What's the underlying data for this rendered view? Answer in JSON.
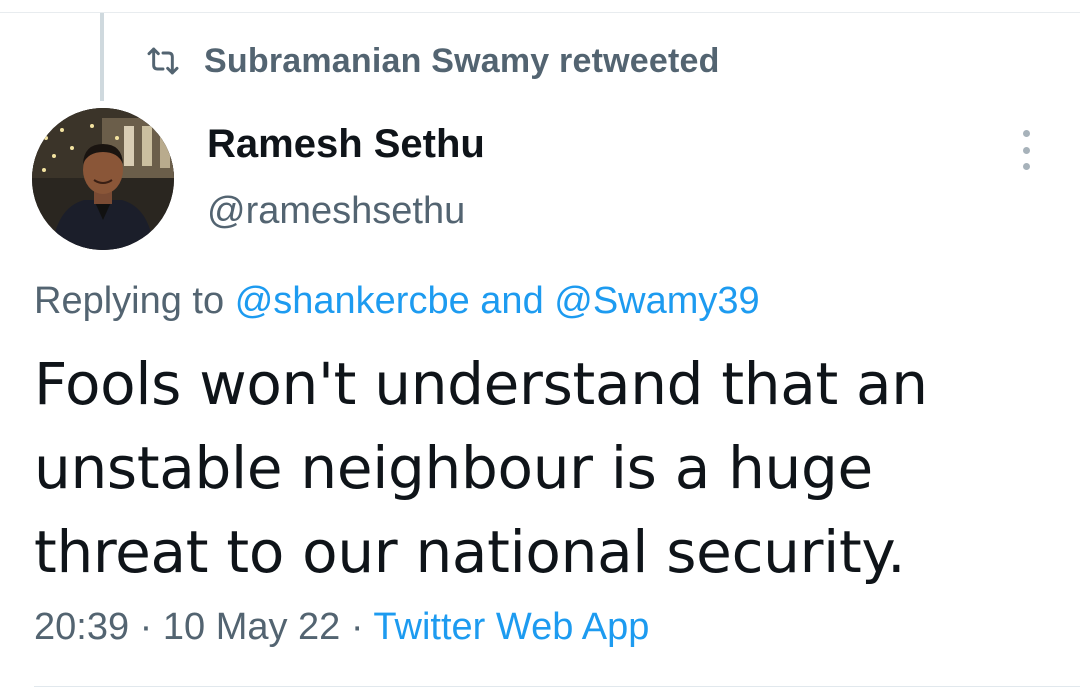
{
  "retweet": {
    "icon": "retweet-icon",
    "text": "Subramanian Swamy retweeted"
  },
  "author": {
    "display_name": "Ramesh Sethu",
    "handle": "@rameshsethu",
    "avatar": "avatar-photo"
  },
  "more_icon": "more-vertical-icon",
  "reply": {
    "prefix": "Replying to",
    "mention1": "@shankercbe",
    "joiner": "and",
    "mention2": "@Swamy39"
  },
  "tweet": {
    "lines": [
      "Fools won't understand that an",
      "unstable neighbour is a huge",
      "threat to our national security."
    ]
  },
  "meta": {
    "time": "20:39",
    "separator": "·",
    "date": "10 May 22",
    "source": "Twitter Web App"
  },
  "colors": {
    "accent": "#1d9bf0",
    "secondary_text": "#536471",
    "primary_text": "#0f1419"
  }
}
